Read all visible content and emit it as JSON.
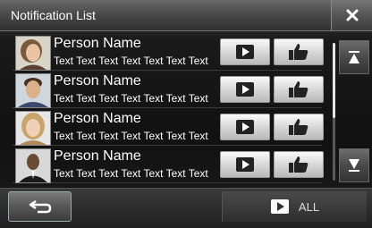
{
  "header": {
    "title": "Notification List",
    "close_icon": "close-icon"
  },
  "notifications": [
    {
      "name": "Person Name",
      "message": "Text Text Text Text Text Text Text",
      "avatar": "person-avatar-1",
      "play_icon": "play-icon",
      "like_icon": "thumbs-up-icon"
    },
    {
      "name": "Person Name",
      "message": "Text Text Text Text Text Text Text",
      "avatar": "person-avatar-2",
      "play_icon": "play-icon",
      "like_icon": "thumbs-up-icon"
    },
    {
      "name": "Person Name",
      "message": "Text Text Text Text Text Text Text",
      "avatar": "person-avatar-3",
      "play_icon": "play-icon",
      "like_icon": "thumbs-up-icon"
    },
    {
      "name": "Person Name",
      "message": "Text Text Text Text Text Text Text",
      "avatar": "person-avatar-4",
      "play_icon": "play-icon",
      "like_icon": "thumbs-up-icon"
    }
  ],
  "scroll": {
    "up_icon": "scroll-up-icon",
    "down_icon": "scroll-down-icon"
  },
  "footer": {
    "back_icon": "back-arrow-icon",
    "play_all_icon": "play-icon",
    "play_all_label": "ALL"
  },
  "colors": {
    "button_face": "#d8d8d8",
    "icon_dark": "#222222",
    "text": "#ffffff"
  }
}
